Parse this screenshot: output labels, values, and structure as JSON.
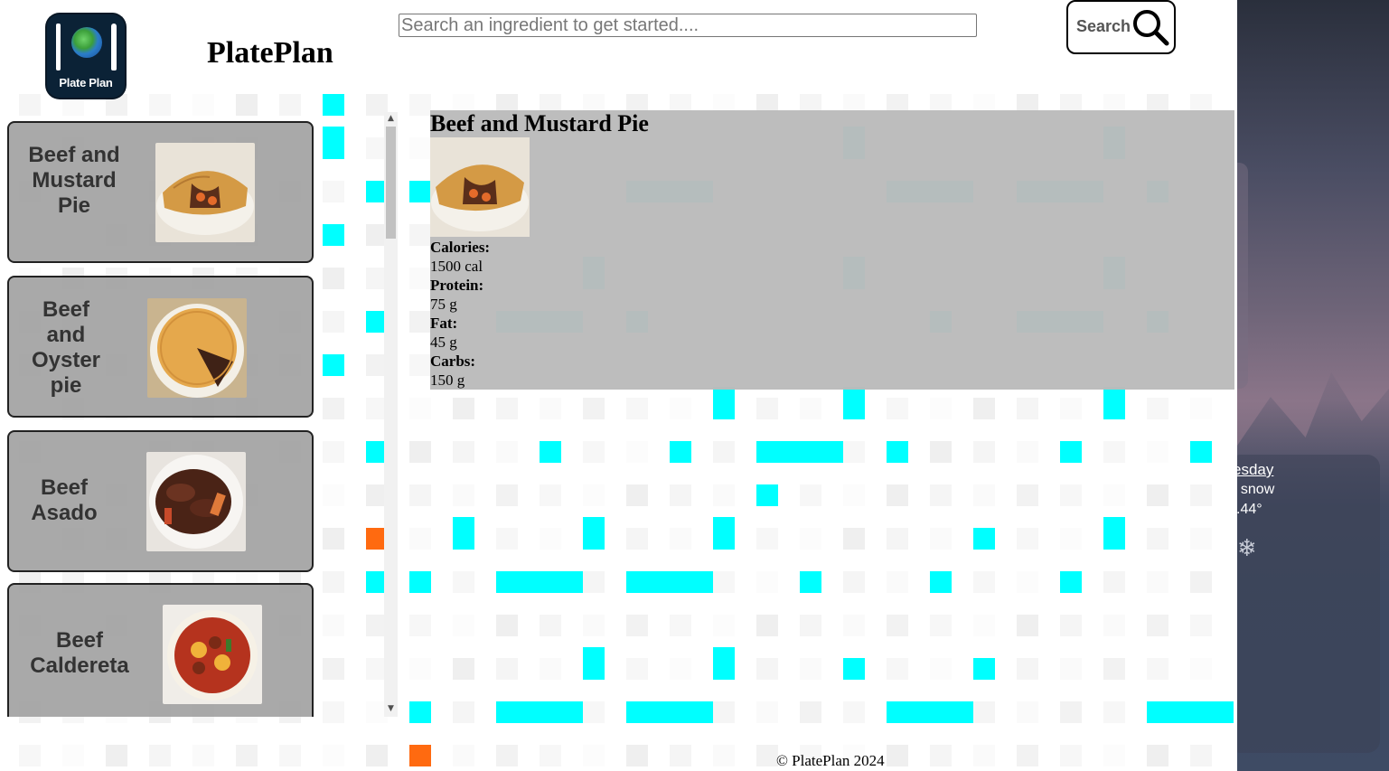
{
  "header": {
    "logo_text": "Plate Plan",
    "brand": "PlatePlan",
    "search_placeholder": "Search an ingredient to get started....",
    "search_button_label": "Search"
  },
  "recipes": [
    {
      "title": "Beef and Mustard Pie"
    },
    {
      "title": "Beef and Oyster pie"
    },
    {
      "title": "Beef Asado"
    },
    {
      "title": "Beef Caldereta"
    }
  ],
  "detail": {
    "title": "Beef and Mustard Pie",
    "calories_label": "Calories:",
    "calories_value": "1500 cal",
    "protein_label": "Protein:",
    "protein_value": "75 g",
    "fat_label": "Fat:",
    "fat_value": "45 g",
    "carbs_label": "Carbs:",
    "carbs_value": "150 g"
  },
  "footer": {
    "text": "© PlatePlan 2024"
  },
  "desktop_weather": {
    "day": "esday",
    "condition": "t snow",
    "temp": ".44°",
    "icon": "snowflake-icon"
  },
  "colors": {
    "accent_cyan": "#00ffff",
    "accent_orange": "#ff6a10",
    "panel_gray": "#bbbbbb",
    "card_gray": "#a0a0a0"
  }
}
